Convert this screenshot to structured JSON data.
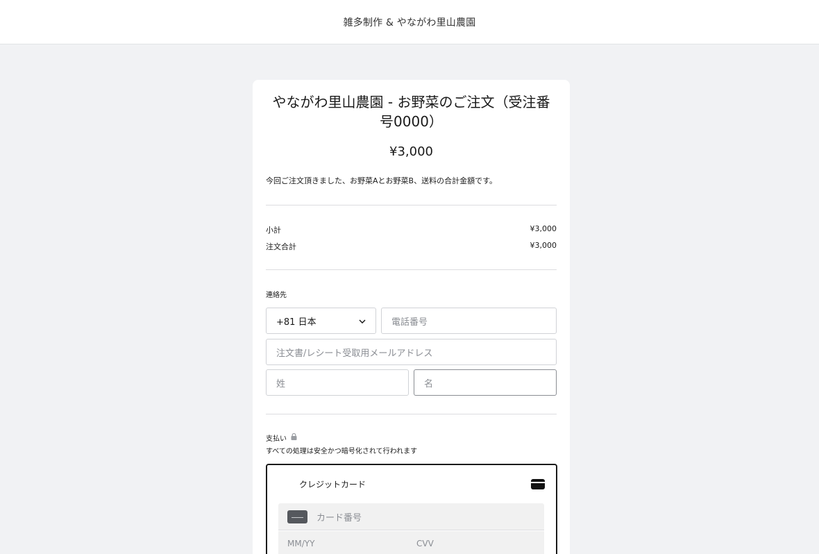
{
  "header": {
    "brand": "雑多制作 & やながわ里山農園"
  },
  "order": {
    "title": "やながわ里山農園 - お野菜のご注文（受注番号0000）",
    "price": "¥3,000",
    "description": "今回ご注文頂きました、お野菜Aとお野菜B、送料の合計金額です。"
  },
  "summary": {
    "subtotal_label": "小計",
    "subtotal_value": "¥3,000",
    "total_label": "注文合計",
    "total_value": "¥3,000"
  },
  "contact": {
    "label": "連絡先",
    "country_code": "+81 日本",
    "phone_placeholder": "電話番号",
    "email_placeholder": "注文書/レシート受取用メールアドレス",
    "last_name_placeholder": "姓",
    "first_name_placeholder": "名"
  },
  "payment": {
    "label": "支払い",
    "secure_note": "すべての処理は安全かつ暗号化されて行われます",
    "method_label": "クレジットカード",
    "card_number_placeholder": "カード番号",
    "expiry_placeholder": "MM/YY",
    "cvv_placeholder": "CVV"
  },
  "icons": {
    "chevron": "chevron-down-icon",
    "lock": "lock-icon",
    "card": "credit-card-icon"
  }
}
